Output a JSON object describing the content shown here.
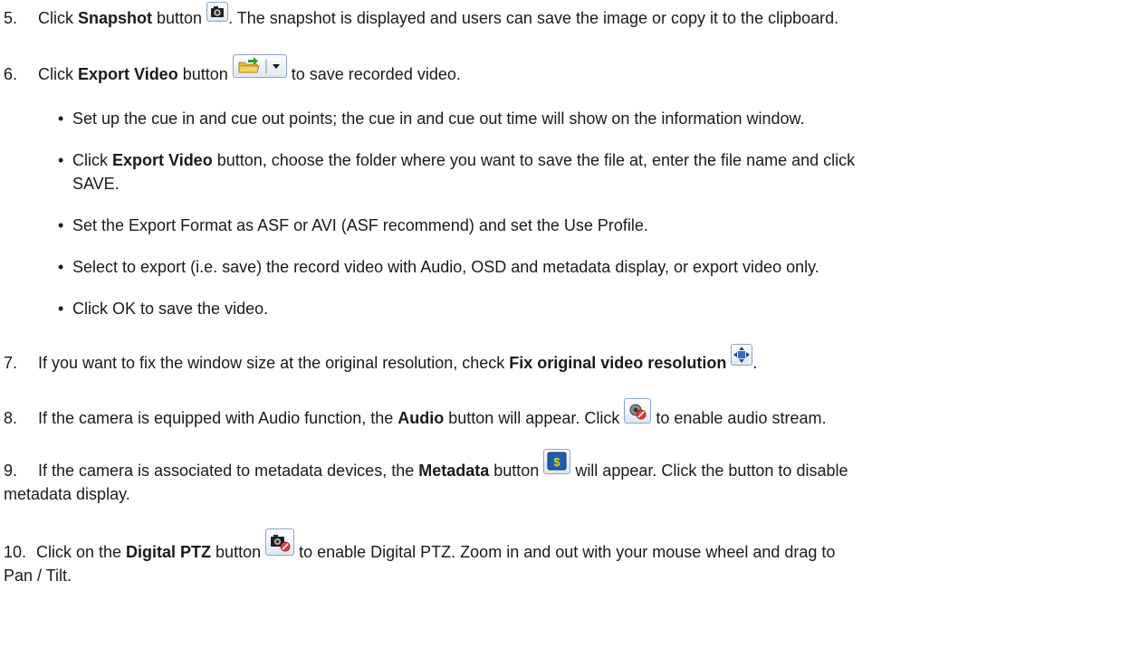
{
  "steps": {
    "s5": {
      "num": "5.",
      "pre": "Click ",
      "bold": "Snapshot",
      "mid": " button ",
      "post": ". The snapshot is displayed and users can save the image or copy it to the clipboard."
    },
    "s6": {
      "num": "6.",
      "pre": "Click ",
      "bold": "Export Video",
      "mid": " button ",
      "post": " to save recorded video.",
      "bullets": [
        {
          "text": "Set up the cue in and cue out points; the cue in and cue out time will show on the information window."
        },
        {
          "pre": "Click ",
          "bold": "Export Video",
          "line1": " button, choose the folder where you want to save the file at, enter the file name and click",
          "line2": "SAVE."
        },
        {
          "text": "Set the Export Format as ASF or AVI (ASF recommend) and set the Use Profile."
        },
        {
          "text": "Select to export (i.e. save) the record video with Audio, OSD and metadata display, or export video only."
        },
        {
          "text": "Click OK to save the video."
        }
      ]
    },
    "s7": {
      "num": "7.",
      "pre": "If you want to fix the window size at the original resolution, check ",
      "bold": "Fix original video resolution",
      "post": "."
    },
    "s8": {
      "num": "8.",
      "pre": "If the camera is equipped with Audio function, the ",
      "bold": "Audio",
      "mid": " button will appear. Click ",
      "post": " to enable audio stream."
    },
    "s9": {
      "num": "9.",
      "pre": "If the camera is associated to metadata devices, the ",
      "bold": "Metadata",
      "mid": " button ",
      "post": " will appear. Click the button to disable",
      "line2": "metadata display."
    },
    "s10": {
      "num": "10.",
      "pre": "Click on the ",
      "bold": "Digital PTZ",
      "mid": " button ",
      "post": " to enable Digital PTZ.  Zoom in and out with your mouse wheel and drag to",
      "line2": "Pan / Tilt."
    }
  },
  "icons": {
    "snapshot": "camera-icon",
    "export": "folder-export-icon",
    "dropdown": "dropdown-arrow-icon",
    "resolution": "fix-resolution-icon",
    "audio": "audio-icon",
    "metadata": "metadata-icon",
    "ptz": "digital-ptz-icon"
  },
  "colors": {
    "icon_border": "#8aa4c8",
    "folder": "#e8b830",
    "arrow_green": "#2e9a2e",
    "metadata_blue": "#1a5fb4",
    "metadata_symbol": "#f5d000"
  }
}
